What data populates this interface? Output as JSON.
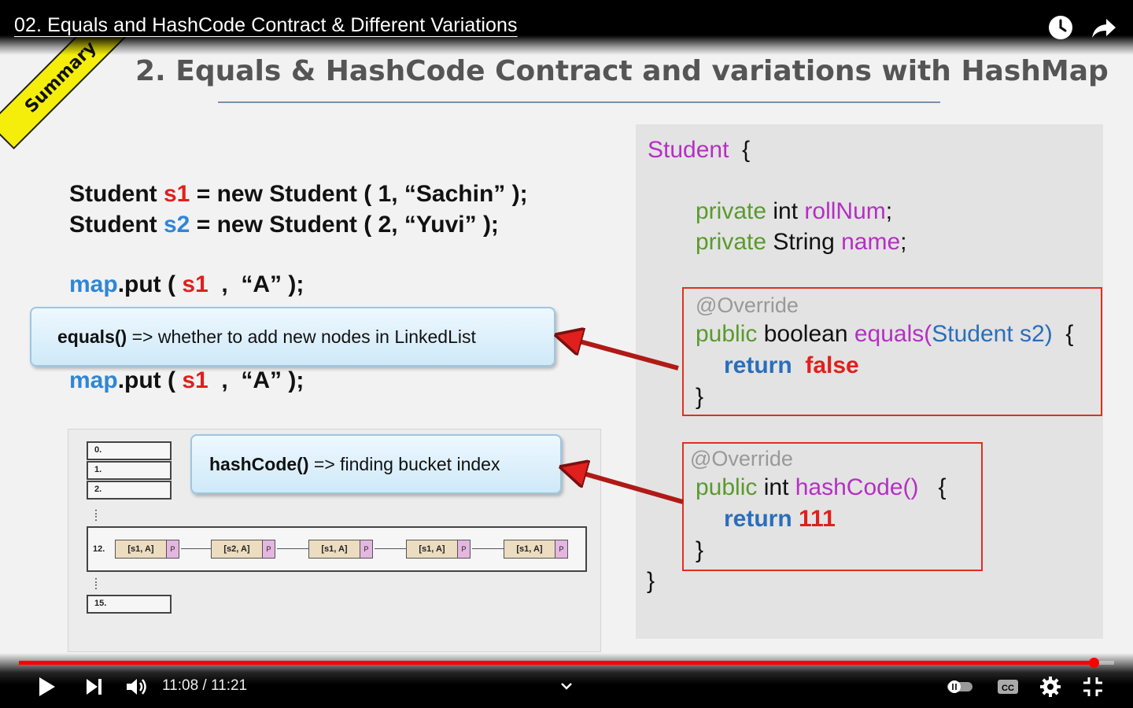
{
  "video": {
    "title": "02. Equals and HashCode Contract & Different Variations",
    "current_time": "11:08",
    "separator": " / ",
    "duration": "11:21",
    "progress": 0.981,
    "icons": {
      "watch_later": "clock-icon",
      "share": "share-icon"
    }
  },
  "slide": {
    "ribbon": "Summary",
    "title": "2. Equals & HashCode Contract and variations with HashMap",
    "left_code": {
      "line1": {
        "a": "Student ",
        "b": "s1",
        "c": " = new Student ( 1, “Sachin” );"
      },
      "line2": {
        "a": "Student ",
        "b": "s2",
        "c": " = new Student ( 2, “Yuvi” );"
      },
      "line3": {
        "a": "map",
        "b": ".put ( ",
        "c": "s1",
        "d": "  ,  “A” );"
      },
      "line4": {
        "a": "map",
        "b": ".put ( ",
        "c": "s1",
        "d": "  ,  “A” );"
      }
    },
    "callout_equals": {
      "method": "equals()",
      "text": " => whether to add new nodes in LinkedList"
    },
    "callout_hash": {
      "method": "hashCode()",
      "text": " => finding bucket index"
    },
    "diagram": {
      "buckets": [
        "0.",
        "1.",
        "2.",
        "12.",
        "15."
      ],
      "dots": ":",
      "nodes": [
        {
          "value": "[s1, A]",
          "ptr": "P"
        },
        {
          "value": "[s2, A]",
          "ptr": "P"
        },
        {
          "value": "[s1, A]",
          "ptr": "P"
        },
        {
          "value": "[s1, A]",
          "ptr": "P"
        },
        {
          "value": "[s1, A]",
          "ptr": "P"
        }
      ]
    },
    "java": {
      "class_name": "Student",
      "open_brace": "{",
      "field1": {
        "mod": "private",
        "type": " int ",
        "name": "rollNum",
        "end": ";"
      },
      "field2": {
        "mod": "private",
        "type": " String ",
        "name": "name",
        "end": ";"
      },
      "equals": {
        "annotation": "@Override",
        "mod": "public",
        "type": " boolean ",
        "name": "equals(",
        "param": "Student s2)",
        "brace": "{",
        "ret": "return",
        "val": "false",
        "close": "}"
      },
      "hashcode": {
        "annotation": "@Override",
        "mod": "public",
        "type": " int ",
        "name": "hashCode()",
        "brace": "{",
        "ret": "return",
        "val": "111",
        "close": "}"
      },
      "close_brace": "}"
    }
  },
  "colors": {
    "progress": "#ff0000",
    "ribbon": "#f5ee0a",
    "box_border": "#e0301e"
  }
}
